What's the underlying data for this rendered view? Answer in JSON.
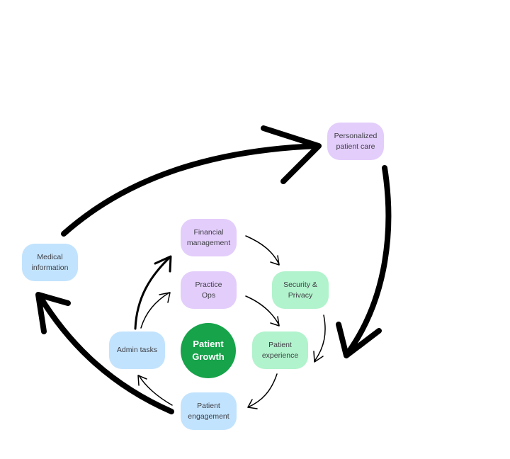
{
  "diagram": {
    "center": {
      "label": "Patient\nGrowth",
      "color": "#16a34a"
    },
    "nodes": [
      {
        "id": "personalized-patient-care",
        "label": "Personalized\npatient care",
        "color": "#e3cdfb"
      },
      {
        "id": "medical-information",
        "label": "Medical\ninformation",
        "color": "#c2e3fd"
      },
      {
        "id": "financial-management",
        "label": "Financial\nmanagement",
        "color": "#e3cdfb"
      },
      {
        "id": "practice-ops",
        "label": "Practice\nOps",
        "color": "#e3cdfb"
      },
      {
        "id": "security-privacy",
        "label": "Security &\nPrivacy",
        "color": "#b1f3cc"
      },
      {
        "id": "admin-tasks",
        "label": "Admin tasks",
        "color": "#c2e3fd"
      },
      {
        "id": "patient-experience",
        "label": "Patient\nexperience",
        "color": "#b1f3cc"
      },
      {
        "id": "patient-engagement",
        "label": "Patient\nengagement",
        "color": "#c2e3fd"
      }
    ],
    "edges": [
      {
        "from": "medical-information",
        "to": "personalized-patient-care",
        "weight": "thick"
      },
      {
        "from": "personalized-patient-care",
        "to": "patient-experience",
        "weight": "thick"
      },
      {
        "from": "patient-engagement",
        "to": "medical-information",
        "weight": "thick"
      },
      {
        "from": "admin-tasks",
        "to": "financial-management",
        "weight": "medium"
      },
      {
        "from": "admin-tasks",
        "to": "practice-ops",
        "weight": "thin"
      },
      {
        "from": "financial-management",
        "to": "security-privacy",
        "weight": "thin"
      },
      {
        "from": "practice-ops",
        "to": "patient-experience",
        "weight": "thin"
      },
      {
        "from": "security-privacy",
        "to": "patient-experience",
        "weight": "thin"
      },
      {
        "from": "patient-experience",
        "to": "patient-engagement",
        "weight": "thin"
      },
      {
        "from": "patient-engagement",
        "to": "admin-tasks",
        "weight": "thin"
      }
    ]
  }
}
